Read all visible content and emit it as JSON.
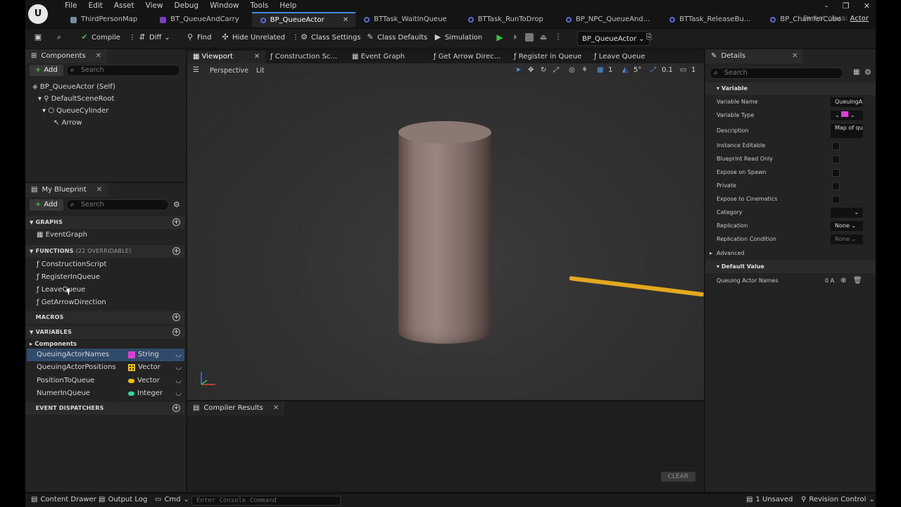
{
  "menu": [
    "File",
    "Edit",
    "Asset",
    "View",
    "Debug",
    "Window",
    "Tools",
    "Help"
  ],
  "tabs": [
    {
      "label": "ThirdPersonMap",
      "icon": "map"
    },
    {
      "label": "BT_QueueAndCarry",
      "icon": "bt"
    },
    {
      "label": "BP_QueueActor",
      "icon": "bp",
      "active": true
    },
    {
      "label": "BTTask_WaitInQueue",
      "icon": "bp"
    },
    {
      "label": "BTTask_RunToDrop",
      "icon": "bp"
    },
    {
      "label": "BP_NPC_QueueAnd...",
      "icon": "bp"
    },
    {
      "label": "BTTask_ReleaseBu...",
      "icon": "bp"
    },
    {
      "label": "BP_ChamferCube",
      "icon": "bp"
    }
  ],
  "parent_class": {
    "label": "Parent class:",
    "value": "Actor"
  },
  "toolbar": {
    "compile": "Compile",
    "diff": "Diff",
    "find": "Find",
    "hide_unrelated": "Hide Unrelated",
    "class_settings": "Class Settings",
    "class_defaults": "Class Defaults",
    "simulation": "Simulation",
    "actor_dropdown": "BP_QueueActor"
  },
  "components": {
    "tab": "Components",
    "add": "Add",
    "search_placeholder": "Search",
    "tree": [
      "BP_QueueActor (Self)",
      "DefaultSceneRoot",
      "QueueCylinder",
      "Arrow"
    ]
  },
  "my_blueprint": {
    "tab": "My Blueprint",
    "add": "Add",
    "search_placeholder": "Search",
    "graphs_label": "GRAPHS",
    "graphs": [
      "EventGraph"
    ],
    "functions_label": "FUNCTIONS",
    "functions_count": "(22 OVERRIDABLE)",
    "functions": [
      "ConstructionScript",
      "RegisterInQueue",
      "LeaveQueue",
      "GetArrowDirection"
    ],
    "macros_label": "MACROS",
    "variables_label": "VARIABLES",
    "components_label": "Components",
    "variables": [
      {
        "name": "QueuingActorNames",
        "type": "String",
        "color": "#e03cd8"
      },
      {
        "name": "QueuingActorPositions",
        "type": "Vector",
        "color": "#f0c010"
      },
      {
        "name": "PositionToQueue",
        "type": "Vector",
        "color": "#f0c010"
      },
      {
        "name": "NumerInQueue",
        "type": "Integer",
        "color": "#2fd8a0"
      }
    ],
    "event_dispatchers_label": "EVENT DISPATCHERS"
  },
  "editor_tabs": [
    "Viewport",
    "Construction Sc...",
    "Event Graph",
    "Get Arrow Direc...",
    "Register in Queue",
    "Leave Queue"
  ],
  "viewport": {
    "perspective": "Perspective",
    "lit": "Lit",
    "grid": "1",
    "angle": "5°",
    "scale": "0.1",
    "cams": "1"
  },
  "compiler": {
    "tab": "Compiler Results",
    "clear": "CLEAR"
  },
  "details": {
    "tab": "Details",
    "search_placeholder": "Search",
    "variable_section": "Variable",
    "variable_name_label": "Variable Name",
    "variable_name_value": "QueuingA",
    "variable_type_label": "Variable Type",
    "description_label": "Description",
    "description_value": "Map of que",
    "instance_editable": "Instance Editable",
    "blueprint_read_only": "Blueprint Read Only",
    "expose_on_spawn": "Expose on Spawn",
    "private": "Private",
    "expose_cinematics": "Expose to Cinematics",
    "category": "Category",
    "replication": "Replication",
    "replication_value": "None",
    "replication_condition": "Replication Condition",
    "replication_condition_value": "None",
    "advanced": "Advanced",
    "default_value_section": "Default Value",
    "queuing_actor_names": "Queuing Actor Names",
    "array_count": "0 A"
  },
  "statusbar": {
    "content_drawer": "Content Drawer",
    "output_log": "Output Log",
    "cmd": "Cmd",
    "console_placeholder": "Enter Console Command",
    "unsaved": "1 Unsaved",
    "revision_control": "Revision Control"
  }
}
